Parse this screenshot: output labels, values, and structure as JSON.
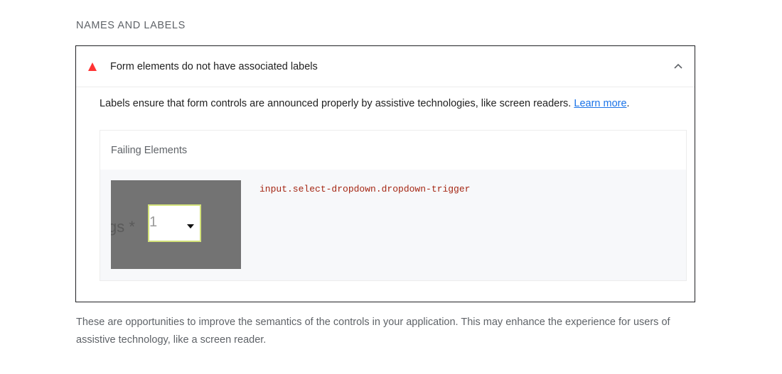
{
  "section": {
    "title": "NAMES AND LABELS"
  },
  "audit": {
    "status": "fail",
    "status_color": "#ff3333",
    "title": "Form elements do not have associated labels",
    "expanded": true,
    "description": "Labels ensure that form controls are announced properly by assistive technologies, like screen readers. ",
    "learn_more": "Learn more",
    "description_end": "."
  },
  "details": {
    "header": "Failing Elements",
    "items": [
      {
        "selector": "input.select-dropdown.dropdown-trigger",
        "thumbnail": {
          "label_fragment": "gs *",
          "value": "1"
        }
      }
    ]
  },
  "footer": {
    "text": "These are opportunities to improve the semantics of the controls in your application. This may enhance the experience for users of assistive technology, like a screen reader."
  }
}
